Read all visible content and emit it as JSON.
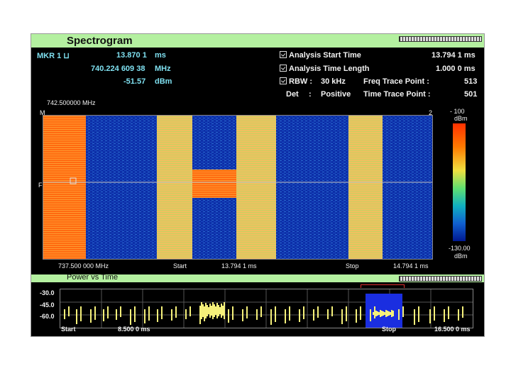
{
  "header": {
    "title": "Spectrogram"
  },
  "marker": {
    "label": "MKR 1 ⊔",
    "time": "13.870 1",
    "time_unit": "ms",
    "freq": "740.224 609 38",
    "freq_unit": "MHz",
    "level": "-51.57",
    "level_unit": "dBm"
  },
  "analysis": {
    "start_time_label": "Analysis Start Time",
    "start_time_value": "13.794 1 ms",
    "time_length_label": "Analysis Time Length",
    "time_length_value": "1.000 0 ms",
    "rbw_label": "RBW :",
    "rbw_value": "30 kHz",
    "freq_trace_label": "Freq Trace Point :",
    "freq_trace_value": "513",
    "det_label": "Det",
    "det_sep": ":",
    "det_value": "Positive",
    "time_trace_label": "Time Trace Point :",
    "time_trace_value": "501"
  },
  "spectrogram": {
    "top_freq": "742.500000 MHz",
    "bottom_freq": "737.500 000 MHz",
    "start_label": "Start",
    "start_value": "13.794 1 ms",
    "stop_label": "Stop",
    "stop_value": "14.794 1 ms",
    "marker_tag": "M",
    "left_tag": "F",
    "right_tag": "2",
    "colorbar_top": "- 100",
    "colorbar_top_unit": "dBm",
    "colorbar_bottom": "-130.00",
    "colorbar_bottom_unit": "dBm",
    "colors": {
      "background": "#0a2a9a",
      "burst": "#f0c060",
      "hot": "#ff6a10"
    }
  },
  "pvt": {
    "title": "Power vs Time",
    "yticks": [
      "-30.0",
      "-45.0",
      "-60.0"
    ],
    "start_label": "Start",
    "start_value": "8.500 0 ms",
    "stop_label": "Stop",
    "stop_value": "16.500 0 ms",
    "colors": {
      "trace": "#f5f07a",
      "window": "#1a2ee0",
      "window_edge": "#e03030"
    }
  }
}
